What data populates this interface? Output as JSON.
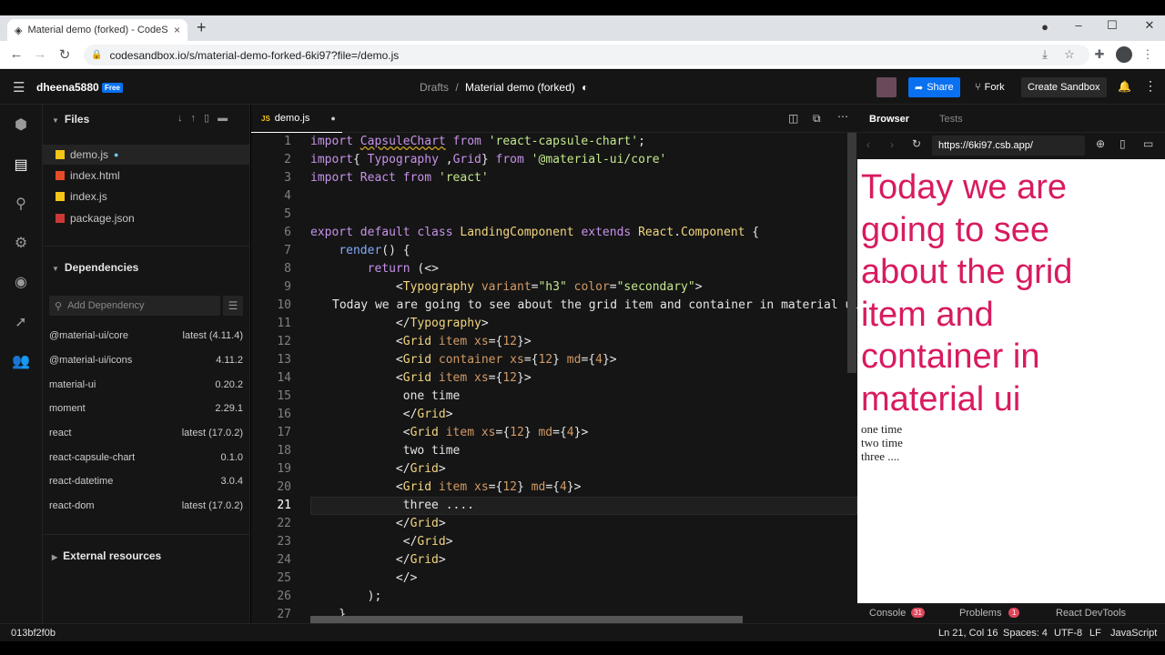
{
  "browser": {
    "tab_title": "Material demo (forked) - CodeSa",
    "tab_close": "×",
    "new_tab": "+",
    "url": "codesandbox.io/s/material-demo-forked-6ki97?file=/demo.js"
  },
  "header": {
    "user": "dheena5880",
    "badge": "Free",
    "crumb_parent": "Drafts",
    "crumb_sep": "/",
    "crumb_current": "Material demo (forked)",
    "share": "Share",
    "fork": "Fork",
    "create": "Create Sandbox"
  },
  "sidebar": {
    "files_title": "Files",
    "files": [
      {
        "name": "demo.js",
        "color": "#f5c518"
      },
      {
        "name": "index.html",
        "color": "#e44d26"
      },
      {
        "name": "index.js",
        "color": "#f5c518"
      },
      {
        "name": "package.json",
        "color": "#cb3837"
      }
    ],
    "deps_title": "Dependencies",
    "dep_placeholder": "Add Dependency",
    "deps": [
      {
        "name": "@material-ui/core",
        "version": "latest (4.11.4)"
      },
      {
        "name": "@material-ui/icons",
        "version": "4.11.2"
      },
      {
        "name": "material-ui",
        "version": "0.20.2"
      },
      {
        "name": "moment",
        "version": "2.29.1"
      },
      {
        "name": "react",
        "version": "latest (17.0.2)"
      },
      {
        "name": "react-capsule-chart",
        "version": "0.1.0"
      },
      {
        "name": "react-datetime",
        "version": "3.0.4"
      },
      {
        "name": "react-dom",
        "version": "latest (17.0.2)"
      }
    ],
    "external_title": "External resources"
  },
  "editor": {
    "tab": "demo.js",
    "tab_badge": "JS",
    "line_numbers": [
      "1",
      "2",
      "3",
      "4",
      "5",
      "6",
      "7",
      "8",
      "9",
      "10",
      "11",
      "12",
      "13",
      "14",
      "15",
      "16",
      "17",
      "18",
      "19",
      "20",
      "21",
      "22",
      "23",
      "24",
      "25",
      "26",
      "27"
    ]
  },
  "preview": {
    "tab_browser": "Browser",
    "tab_tests": "Tests",
    "url": "https://6ki97.csb.app/",
    "heading_lines": [
      "Today we are",
      "going to see",
      "about the grid",
      "item and",
      "container in",
      "material ui"
    ],
    "items": [
      "one time",
      "two time",
      "three ...."
    ]
  },
  "console_bar": {
    "console": "Console",
    "console_count": "31",
    "problems": "Problems",
    "problems_count": "1",
    "devtools": "React DevTools"
  },
  "status": {
    "commit": "013bf2f0b",
    "position": "Ln 21, Col 16",
    "spaces": "Spaces: 4",
    "encoding": "UTF-8",
    "eol": "LF",
    "language": "JavaScript"
  }
}
